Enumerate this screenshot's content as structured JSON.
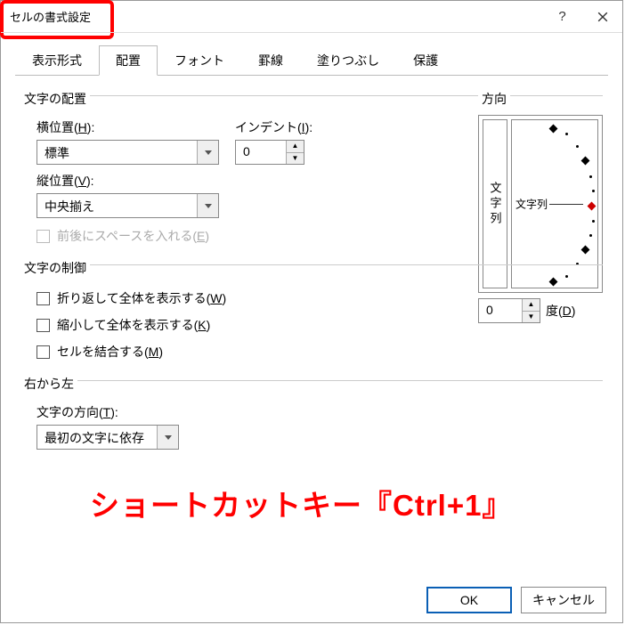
{
  "window": {
    "title": "セルの書式設定"
  },
  "tabs": [
    "表示形式",
    "配置",
    "フォント",
    "罫線",
    "塗りつぶし",
    "保護"
  ],
  "active_tab_index": 1,
  "alignment": {
    "group": "文字の配置",
    "horizontal_label_pre": "横位置(",
    "horizontal_key": "H",
    "horizontal_label_post": "):",
    "horizontal_value": "標準",
    "vertical_label_pre": "縦位置(",
    "vertical_key": "V",
    "vertical_label_post": "):",
    "vertical_value": "中央揃え",
    "indent_label_pre": "インデント(",
    "indent_key": "I",
    "indent_label_post": "):",
    "indent_value": "0",
    "distribute_label_pre": "前後にスペースを入れる(",
    "distribute_key": "E",
    "distribute_label_post": ")"
  },
  "control": {
    "group": "文字の制御",
    "wrap_pre": "折り返して全体を表示する(",
    "wrap_key": "W",
    "wrap_post": ")",
    "shrink_pre": "縮小して全体を表示する(",
    "shrink_key": "K",
    "shrink_post": ")",
    "merge_pre": "セルを結合する(",
    "merge_key": "M",
    "merge_post": ")"
  },
  "rtl": {
    "group": "右から左",
    "dir_label_pre": "文字の方向(",
    "dir_key": "T",
    "dir_label_post": "):",
    "dir_value": "最初の文字に依存"
  },
  "orientation": {
    "group": "方向",
    "vertical_text": "文字列",
    "dial_text": "文字列",
    "degree_value": "0",
    "degree_label_pre": "度(",
    "degree_key": "D",
    "degree_label_post": ")"
  },
  "buttons": {
    "ok": "OK",
    "cancel": "キャンセル"
  },
  "annotation": "ショートカットキー『Ctrl+1』"
}
